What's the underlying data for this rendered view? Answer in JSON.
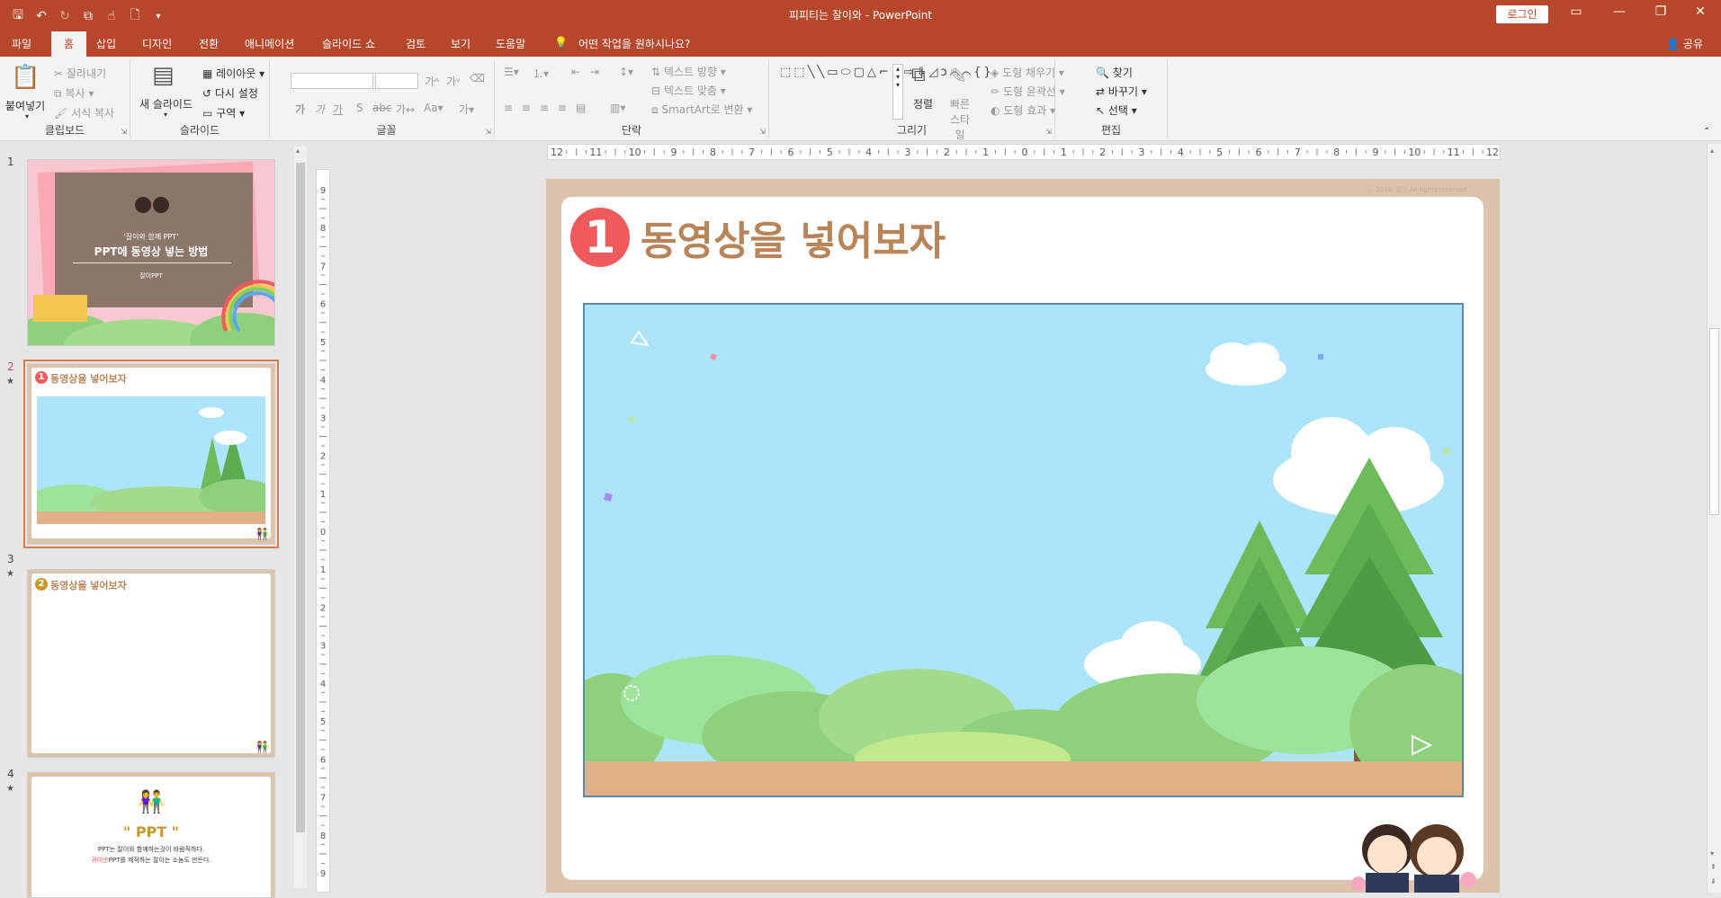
{
  "window": {
    "title": "피피티는 잘이와  -  PowerPoint",
    "login_label": "로그인",
    "share_label": "공유"
  },
  "tabs": [
    "파일",
    "홈",
    "삽입",
    "디자인",
    "전환",
    "애니메이션",
    "슬라이드 쇼",
    "검토",
    "보기",
    "도움말"
  ],
  "tell_me": "어떤 작업을 원하시나요?",
  "ribbon": {
    "clipboard": {
      "label": "클립보드",
      "paste": "붙여넣기",
      "cut": "잘라내기",
      "copy": "복사",
      "format_painter": "서식 복사"
    },
    "slides": {
      "label": "슬라이드",
      "new_slide": "새 슬라이드",
      "layout": "레이아웃",
      "reset": "다시 설정",
      "section": "구역"
    },
    "font": {
      "label": "글꼴",
      "font_name": "",
      "font_size": ""
    },
    "paragraph": {
      "label": "단락",
      "text_direction": "텍스트 방향",
      "align_text": "텍스트 맞춤",
      "smartart": "SmartArt로 변환"
    },
    "drawing": {
      "label": "그리기",
      "arrange": "정렬",
      "quick_styles": "빠른 스타일",
      "shape_fill": "도형 채우기",
      "shape_outline": "도형 윤곽선",
      "shape_effects": "도형 효과"
    },
    "editing": {
      "label": "편집",
      "find": "찾기",
      "replace": "바꾸기",
      "select": "선택"
    }
  },
  "slides": [
    {
      "num": "1",
      "subtitle": "'잘이와 함께 PPT'",
      "title": "PPT에 동영상 넣는 방법",
      "brand": "잘이PPT",
      "transition": false
    },
    {
      "num": "2",
      "title": "동영상을 넣어보자",
      "badge": "1",
      "transition": true,
      "selected": true
    },
    {
      "num": "3",
      "title": "동영상을 넣어보자",
      "badge": "2",
      "transition": true
    },
    {
      "num": "4",
      "quote": "\" PPT \"",
      "line1": "PPT는 잘이와 함께하는것이 바람직하다.",
      "line2_highlight": "귀여운",
      "line2": "PPT를 제작하는 잘이는 소놈도 만든다.",
      "transition": true
    }
  ],
  "main_slide": {
    "badge": "1",
    "title": "동영상을 넣어보자",
    "copyright": "ⓒ 2019. 잘이 All rights reserved"
  },
  "ruler": {
    "h_labels": [
      "12",
      "11",
      "10",
      "9",
      "8",
      "7",
      "6",
      "5",
      "4",
      "3",
      "2",
      "1",
      "0",
      "1",
      "2",
      "3",
      "4",
      "5",
      "6",
      "7",
      "8",
      "9",
      "10",
      "11",
      "12"
    ],
    "v_labels": [
      "9",
      "8",
      "7",
      "6",
      "5",
      "4",
      "3",
      "2",
      "1",
      "0",
      "1",
      "2",
      "3",
      "4",
      "5",
      "6",
      "7",
      "8",
      "9"
    ]
  },
  "colors": {
    "accent": "#b7472a",
    "slide_frame": "#dcc4ac",
    "title": "#b8855a",
    "badge": "#f05a5a",
    "sky": "#ace5fb"
  },
  "star_glyph": "★"
}
